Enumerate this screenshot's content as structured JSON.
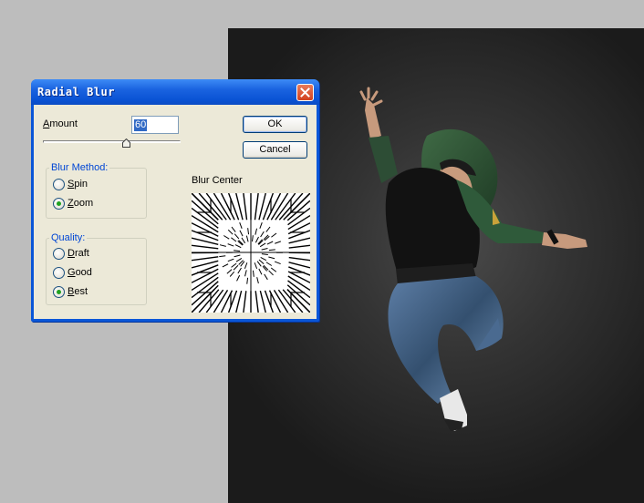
{
  "dialog": {
    "title": "Radial Blur",
    "amount_label_first": "A",
    "amount_label_rest": "mount",
    "amount_value": "60",
    "ok_label": "OK",
    "cancel_label": "Cancel",
    "blur_method": {
      "label": "Blur Method:",
      "options": [
        {
          "first": "S",
          "rest": "pin",
          "selected": false
        },
        {
          "first": "Z",
          "rest": "oom",
          "selected": true
        }
      ]
    },
    "quality": {
      "label": "Quality:",
      "options": [
        {
          "first": "D",
          "rest": "raft",
          "selected": false
        },
        {
          "first": "G",
          "rest": "ood",
          "selected": false
        },
        {
          "first": "B",
          "rest": "est",
          "selected": true
        }
      ]
    },
    "blur_center_label": "Blur Center"
  },
  "colors": {
    "titlebar": "#0a56d8",
    "dialog_bg": "#ece9d8",
    "group_label": "#0046d5",
    "radio_selected": "#21a121",
    "workspace": "#bdbdbd"
  },
  "icons": {
    "close": "close-x-icon"
  }
}
